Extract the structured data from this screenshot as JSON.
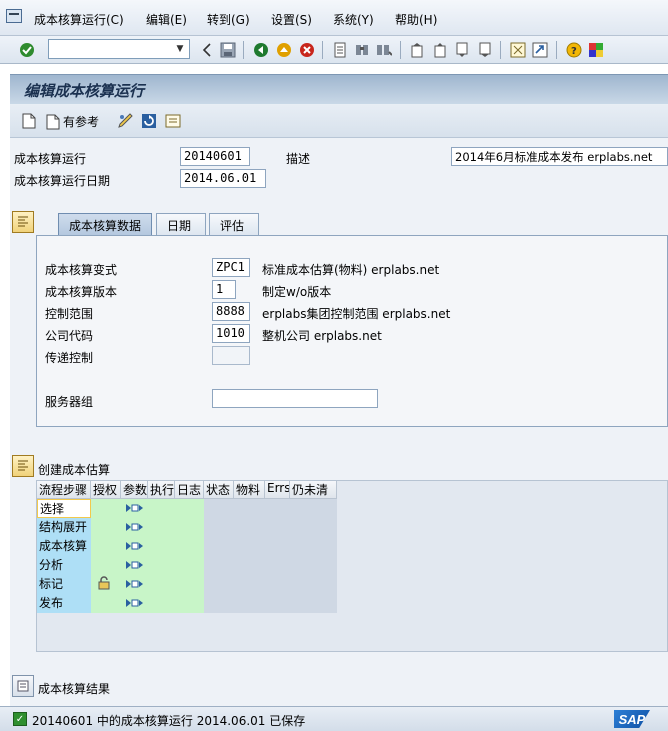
{
  "menu": {
    "items": [
      "成本核算运行(C)",
      "编辑(E)",
      "转到(G)",
      "设置(S)",
      "系统(Y)",
      "帮助(H)"
    ]
  },
  "toolbar": {
    "command_value": "",
    "icons": [
      "enter-icon",
      "save-icon",
      "back-icon",
      "exit-icon",
      "cancel-icon",
      "print-icon",
      "find-icon",
      "find-next-icon",
      "first-page-icon",
      "prev-page-icon",
      "next-page-icon",
      "last-page-icon",
      "create-session-icon",
      "shortcut-icon",
      "help-icon",
      "layout-icon"
    ]
  },
  "title": "编辑成本核算运行",
  "app_toolbar": {
    "ref_label": "有参考",
    "icons": [
      "new-document-icon",
      "copy-reference-icon",
      "edit-pencil-icon",
      "refresh-icon",
      "note-icon"
    ]
  },
  "header": {
    "run_label": "成本核算运行",
    "run_value": "20140601",
    "desc_label": "描述",
    "desc_value": "2014年6月标准成本发布 erplabs.net",
    "date_label": "成本核算运行日期",
    "date_value": "2014.06.01"
  },
  "tabs": [
    "成本核算数据",
    "日期",
    "评估"
  ],
  "costing_data": {
    "variant_label": "成本核算变式",
    "variant_value": "ZPC1",
    "variant_desc": "标准成本估算(物料) erplabs.net",
    "version_label": "成本核算版本",
    "version_value": "1",
    "version_desc": "制定w/o版本",
    "area_label": "控制范围",
    "area_value": "8888",
    "area_desc": "erplabs集团控制范围 erplabs.net",
    "company_label": "公司代码",
    "company_value": "1010",
    "company_desc": "整机公司 erplabs.net",
    "transfer_label": "传递控制",
    "transfer_value": "",
    "server_label": "服务器组",
    "server_value": ""
  },
  "estimate": {
    "section_label": "创建成本估算",
    "columns": [
      "流程步骤",
      "授权",
      "参数",
      "执行",
      "日志",
      "状态",
      "物料",
      "Errs",
      "仍未清"
    ],
    "steps": [
      "选择",
      "结构展开",
      "成本核算",
      "分析",
      "标记",
      "发布"
    ]
  },
  "results_label": "成本核算结果",
  "status": {
    "message": "20140601 中的成本核算运行 2014.06.01 已保存"
  },
  "colors": {
    "step_cell": "#aedff6",
    "green_cols": "#c8f5c8",
    "title_text": "#1b3150"
  }
}
